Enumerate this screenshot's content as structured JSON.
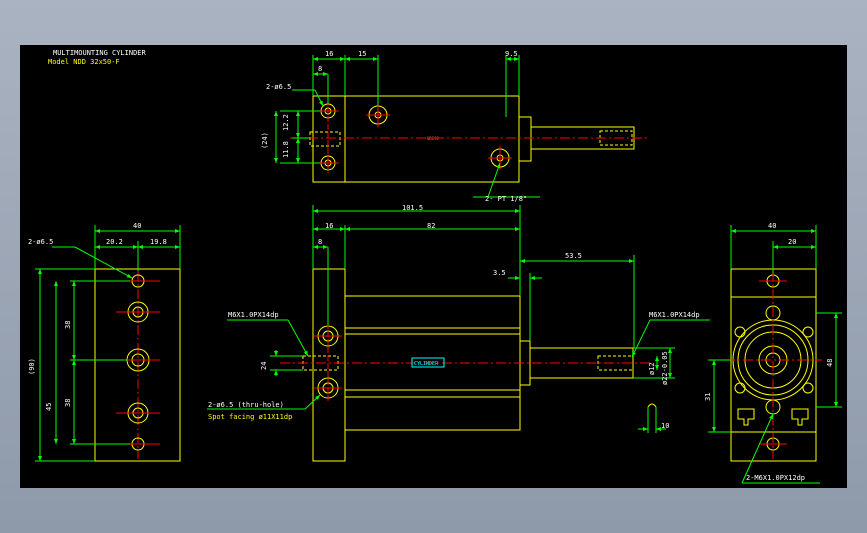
{
  "title": {
    "line1": "MULTIMOUNTING CYLINDER",
    "line2": "Model  NDD  32x50-F"
  },
  "dims_top": {
    "d16": "16",
    "d8": "8",
    "d15": "15",
    "d95": "9.5",
    "holes": "2-ø6.5",
    "d24": "(24)",
    "d122": "12.2",
    "d118": "11.8",
    "port": "2-  PT 1/8\"",
    "rod_mark": "NDD32"
  },
  "dims_front": {
    "d1015": "101.5",
    "d16": "16",
    "d8": "8",
    "d82": "82",
    "d35": "3.5",
    "d535": "53.5",
    "thread_left": "M6X1.0PX14dp",
    "thread_right": "M6X1.0PX14dp",
    "d24": "24",
    "d12": "ø12",
    "d22": "ø22-0.05",
    "thru": "2-ø6.5 (thru-hole)",
    "spot": "Spot facing  ø11X11dp",
    "d10": "10",
    "brand": "CYLINDER"
  },
  "dims_left": {
    "d40": "40",
    "d202": "20.2",
    "d198": "19.8",
    "holes": "2-ø6.5",
    "d90": "(90)",
    "d38a": "38",
    "d45": "45",
    "d38b": "38"
  },
  "dims_right": {
    "d40": "40",
    "d20": "20",
    "d48": "48",
    "d31": "31",
    "thread": "2-M6X1.0PX12dp"
  }
}
